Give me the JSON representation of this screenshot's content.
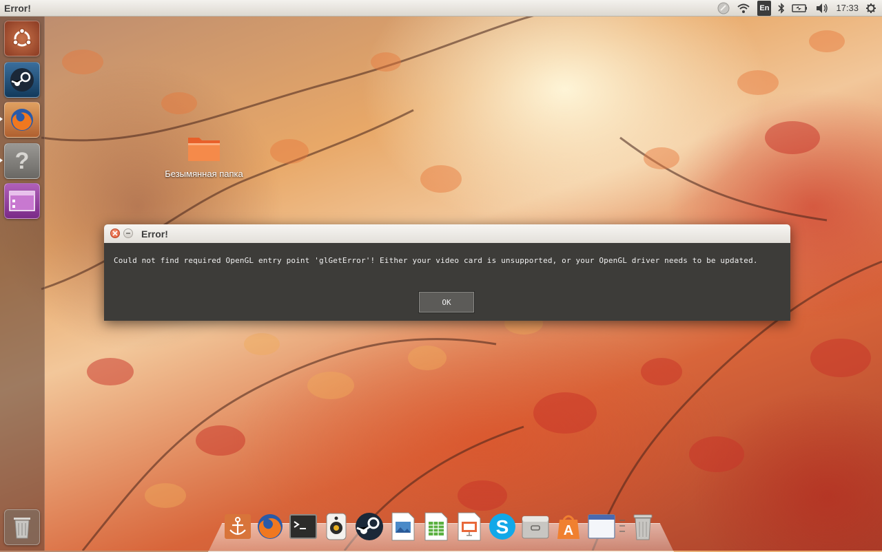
{
  "top_panel": {
    "title": "Error!",
    "language": "En",
    "clock": "17:33",
    "indicators": [
      "steam-tray-icon",
      "wifi-icon",
      "keyboard-layout",
      "bluetooth-icon",
      "battery-icon",
      "volume-icon",
      "clock",
      "session-gear-icon"
    ]
  },
  "launcher": {
    "items": [
      "ubuntu-dash-icon",
      "steam-icon",
      "firefox-icon",
      "help-icon",
      "workspace-switcher-icon",
      "trash-icon"
    ]
  },
  "desktop": {
    "folder_label": "Безымянная папка"
  },
  "dialog": {
    "title": "Error!",
    "message": "Could not find required OpenGL entry point 'glGetError'! Either your video card is unsupported, or your OpenGL driver needs to be updated.",
    "ok_label": "OK"
  },
  "dock": {
    "items": [
      "anchor-icon",
      "firefox-icon",
      "terminal-icon",
      "speaker-app-icon",
      "steam-icon",
      "document-viewer-icon",
      "spreadsheet-icon",
      "presentation-icon",
      "skype-icon",
      "file-manager-icon",
      "software-center-icon",
      "window-icon",
      "trash-icon"
    ]
  },
  "colors": {
    "dialog_bg": "#3d3c39",
    "panel_bg": "#e8e5df",
    "close_button": "#e05530"
  }
}
